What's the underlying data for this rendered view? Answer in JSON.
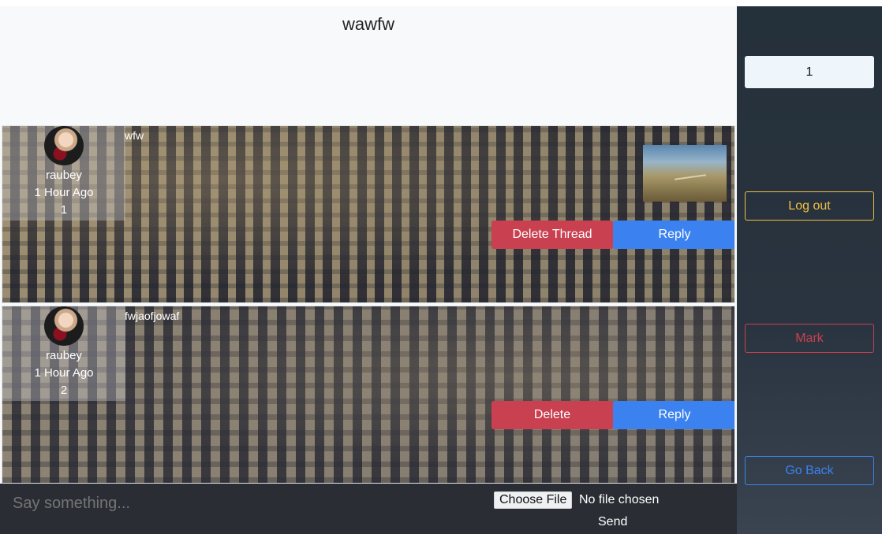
{
  "thread": {
    "title": "wawfw"
  },
  "posts": [
    {
      "author": "raubey",
      "time": "1 Hour Ago",
      "count": "1",
      "text": "wfw",
      "delete_label": "Delete Thread",
      "reply_label": "Reply"
    },
    {
      "author": "raubey",
      "time": "1 Hour Ago",
      "count": "2",
      "text": "fwjaofjowaf",
      "delete_label": "Delete",
      "reply_label": "Reply"
    }
  ],
  "composer": {
    "placeholder": "Say something...",
    "file_button": "Choose File",
    "file_status": "No file chosen",
    "send_label": "Send"
  },
  "sidebar": {
    "page_value": "1",
    "logout_label": "Log out",
    "mark_label": "Mark",
    "goback_label": "Go Back"
  },
  "colors": {
    "danger": "#c94050",
    "primary": "#3b82f0",
    "warning": "#f0c040",
    "sidebar_bg": "#24303a"
  }
}
